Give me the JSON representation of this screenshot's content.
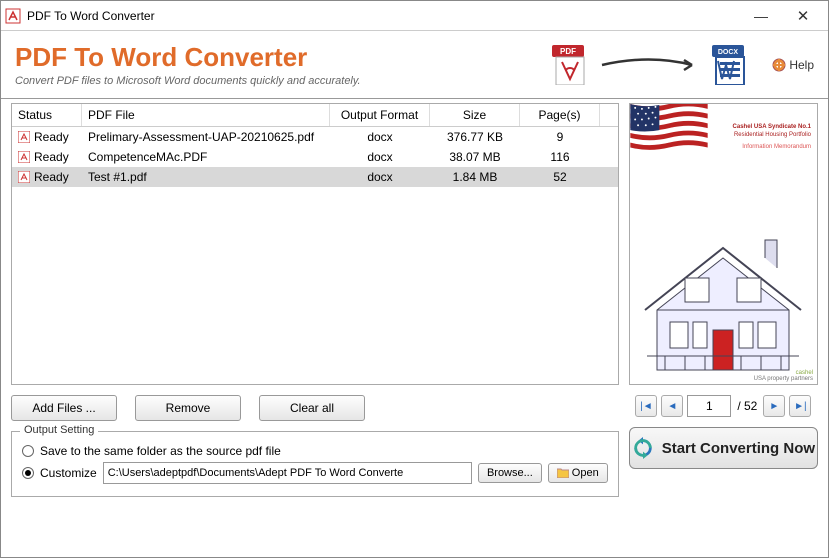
{
  "window": {
    "title": "PDF To Word Converter"
  },
  "header": {
    "title": "PDF To Word Converter",
    "subtitle": "Convert PDF files to Microsoft Word documents quickly and accurately.",
    "pdf_badge": "PDF",
    "docx_badge": "DOCX",
    "help_label": "Help"
  },
  "table": {
    "headers": {
      "status": "Status",
      "file": "PDF File",
      "format": "Output Format",
      "size": "Size",
      "pages": "Page(s)"
    },
    "rows": [
      {
        "status": "Ready",
        "file": "Prelimary-Assessment-UAP-20210625.pdf",
        "format": "docx",
        "size": "376.77 KB",
        "pages": "9",
        "selected": false
      },
      {
        "status": "Ready",
        "file": "CompetenceMAc.PDF",
        "format": "docx",
        "size": "38.07 MB",
        "pages": "116",
        "selected": false
      },
      {
        "status": "Ready",
        "file": "Test #1.pdf",
        "format": "docx",
        "size": "1.84 MB",
        "pages": "52",
        "selected": true
      }
    ]
  },
  "buttons": {
    "add": "Add Files ...",
    "remove": "Remove",
    "clear": "Clear all",
    "browse": "Browse...",
    "open": "Open",
    "start": "Start Converting Now"
  },
  "output": {
    "legend": "Output Setting",
    "same_folder_label": "Save to the same folder as the source pdf file",
    "customize_label": "Customize",
    "path": "C:\\Users\\adeptpdf\\Documents\\Adept PDF To Word Converte",
    "selected": "customize"
  },
  "preview": {
    "doc_title": "Cashel USA Syndicate No.1",
    "doc_sub1": "Residential Housing Portfolio",
    "doc_sub2": "Information Memorandum",
    "footer1": "cashel",
    "footer2": "USA property partners"
  },
  "pager": {
    "current": "1",
    "total": "/ 52"
  }
}
